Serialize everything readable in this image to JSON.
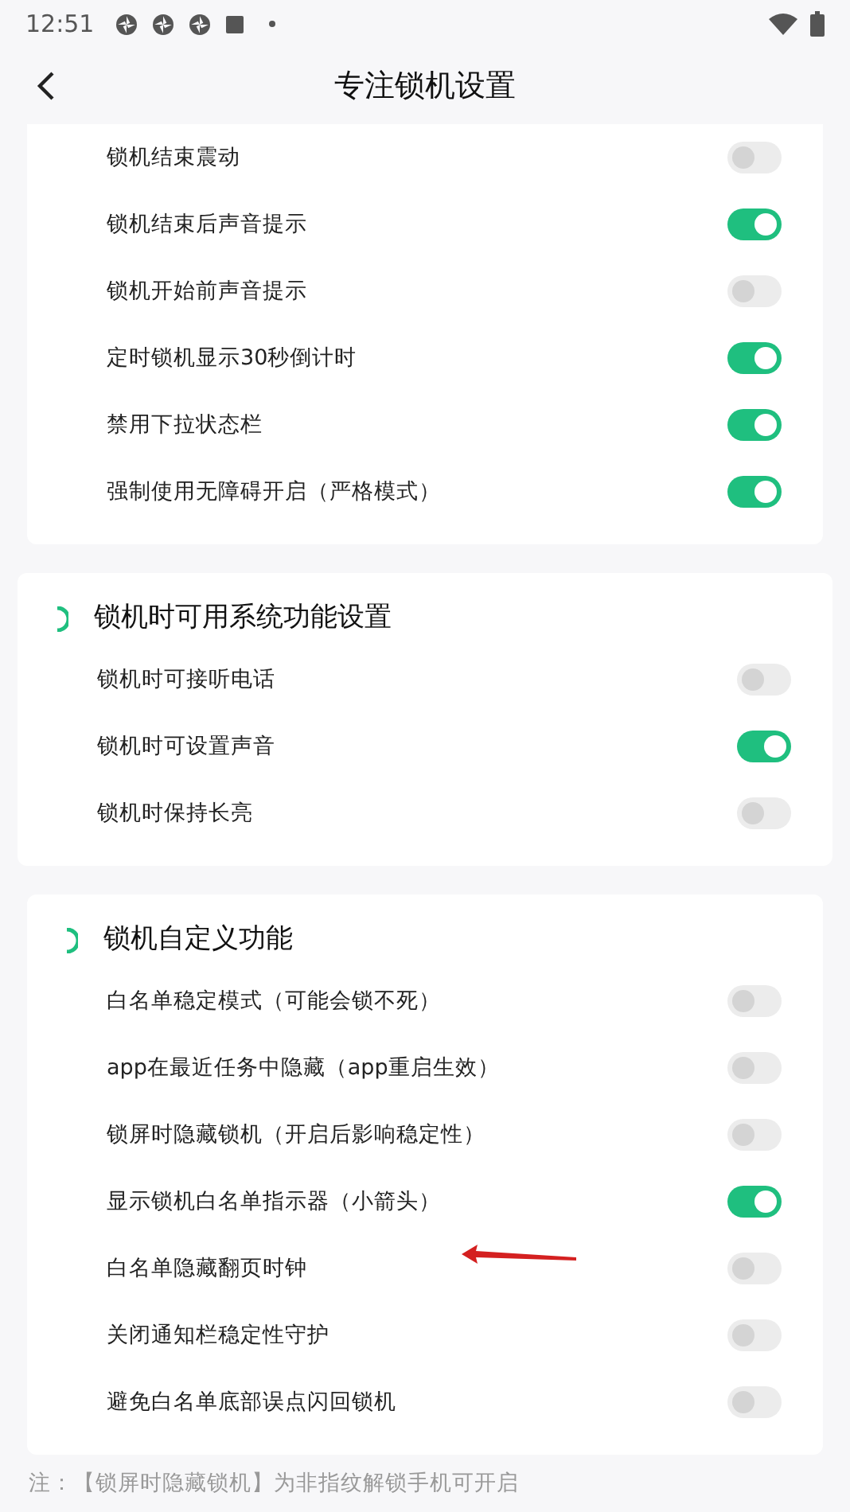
{
  "status_bar": {
    "time": "12:51"
  },
  "header": {
    "title": "专注锁机设置"
  },
  "sections": [
    {
      "rows": [
        {
          "label": "锁机结束震动",
          "on": false
        },
        {
          "label": "锁机结束后声音提示",
          "on": true
        },
        {
          "label": "锁机开始前声音提示",
          "on": false
        },
        {
          "label": "定时锁机显示30秒倒计时",
          "on": true
        },
        {
          "label": "禁用下拉状态栏",
          "on": true
        },
        {
          "label": "强制使用无障碍开启（严格模式）",
          "on": true
        }
      ]
    },
    {
      "title": "锁机时可用系统功能设置",
      "rows": [
        {
          "label": "锁机时可接听电话",
          "on": false
        },
        {
          "label": "锁机时可设置声音",
          "on": true
        },
        {
          "label": "锁机时保持长亮",
          "on": false
        }
      ]
    },
    {
      "title": "锁机自定义功能",
      "rows": [
        {
          "label": "白名单稳定模式（可能会锁不死）",
          "on": false
        },
        {
          "label": "app在最近任务中隐藏（app重启生效）",
          "on": false
        },
        {
          "label": "锁屏时隐藏锁机（开启后影响稳定性）",
          "on": false
        },
        {
          "label": "显示锁机白名单指示器（小箭头）",
          "on": true
        },
        {
          "label": "白名单隐藏翻页时钟",
          "on": false
        },
        {
          "label": "关闭通知栏稳定性守护",
          "on": false
        },
        {
          "label": "避免白名单底部误点闪回锁机",
          "on": false
        }
      ]
    }
  ],
  "note": "注：【锁屏时隐藏锁机】为非指纹解锁手机可开启"
}
